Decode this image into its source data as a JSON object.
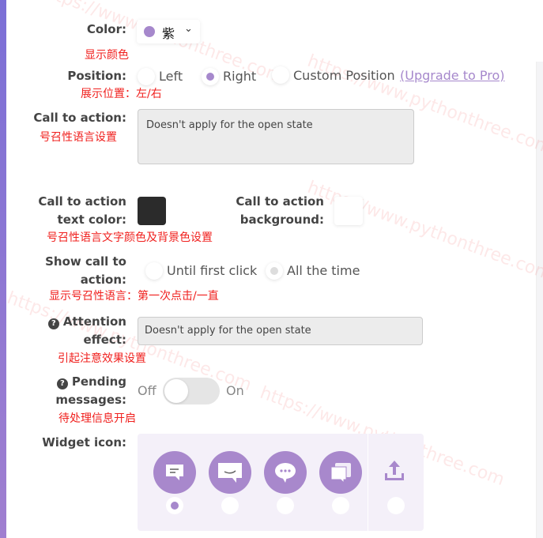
{
  "watermark": "https://www.pythonthree.com",
  "accent": "#a688cc",
  "color": {
    "label": "Color:",
    "value": "紫",
    "swatch": "#a688cc",
    "note": "显示颜色"
  },
  "position": {
    "label": "Position:",
    "options": [
      "Left",
      "Right",
      "Custom Position"
    ],
    "selected": "Right",
    "upgrade": "(Upgrade to Pro)",
    "note": "展示位置：左/右"
  },
  "cta": {
    "label": "Call to action:",
    "value": "Doesn't apply for the open state",
    "note": "号召性语言设置"
  },
  "cta_colors": {
    "text_label_1": "Call to action",
    "text_label_2": "text color:",
    "text_color": "#2b2b2b",
    "bg_label_1": "Call to action",
    "bg_label_2": "background:",
    "bg_color": "#ffffff",
    "note": "号召性语言文字颜色及背景色设置"
  },
  "show_cta": {
    "label_1": "Show call to",
    "label_2": "action:",
    "options": [
      "Until first click",
      "All the time"
    ],
    "selected": "All the time",
    "note": "显示号召性语言：第一次点击/一直"
  },
  "attention": {
    "label_1": "Attention",
    "label_2": "effect:",
    "value": "Doesn't apply for the open state",
    "note": "引起注意效果设置"
  },
  "pending": {
    "label_1": "Pending",
    "label_2": "messages:",
    "off": "Off",
    "on": "On",
    "enabled": false,
    "note": "待处理信息开启"
  },
  "widget_icon": {
    "label": "Widget icon:",
    "icons": [
      "chat-lines-icon",
      "chat-smile-icon",
      "chat-dots-icon",
      "chat-stack-icon",
      "upload-icon"
    ],
    "selected": 0
  }
}
